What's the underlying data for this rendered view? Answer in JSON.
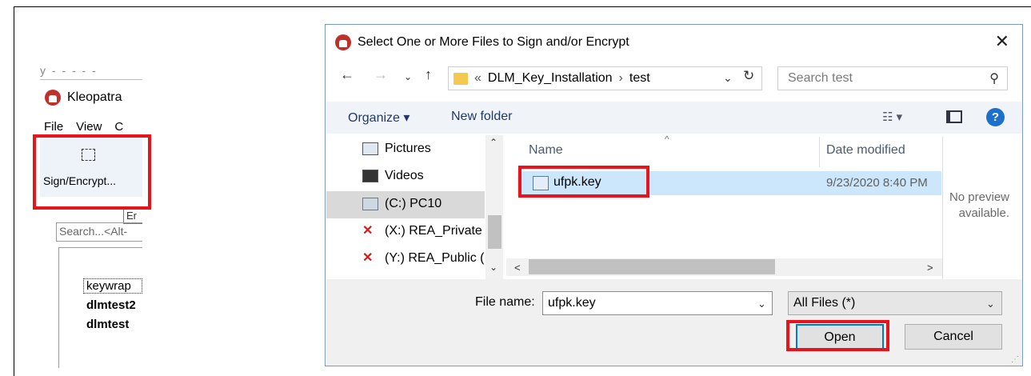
{
  "kleopatra": {
    "title": "Kleopatra",
    "top_fragment": "y - - - - -",
    "menu": [
      "File",
      "View",
      "C"
    ],
    "sign_encrypt_label": "Sign/Encrypt...",
    "tooltip": "Er",
    "search_placeholder": "Search...<Alt-",
    "list": [
      "keywrap",
      "dlmtest2",
      "dlmtest"
    ]
  },
  "dialog": {
    "title": "Select One or More Files to Sign and/or Encrypt",
    "close": "✕",
    "breadcrumb": {
      "prefix": "«",
      "parent": "DLM_Key_Installation",
      "current": "test"
    },
    "search_placeholder": "Search test",
    "commands": {
      "organize": "Organize ▾",
      "new_folder": "New folder"
    },
    "nav_items": [
      {
        "label": "Pictures",
        "icon": "pictures-icon"
      },
      {
        "label": "Videos",
        "icon": "videos-icon"
      },
      {
        "label": "(C:) PC10",
        "icon": "drive-icon"
      },
      {
        "label": "(X:) REA_Private",
        "icon": "network-drive-icon"
      },
      {
        "label": "(Y:) REA_Public (",
        "icon": "network-drive-icon"
      }
    ],
    "columns": {
      "name": "Name",
      "date": "Date modified"
    },
    "files": [
      {
        "name": "ufpk.key",
        "date": "9/23/2020 8:40 PM"
      }
    ],
    "preview_text": [
      "No preview",
      "available."
    ],
    "file_name_label": "File name:",
    "file_name_value": "ufpk.key",
    "file_type": "All Files (*)",
    "open_label": "Open",
    "cancel_label": "Cancel"
  },
  "colors": {
    "highlight": "#e8141c",
    "selection": "#cce6fb",
    "accent": "#0078d7"
  }
}
